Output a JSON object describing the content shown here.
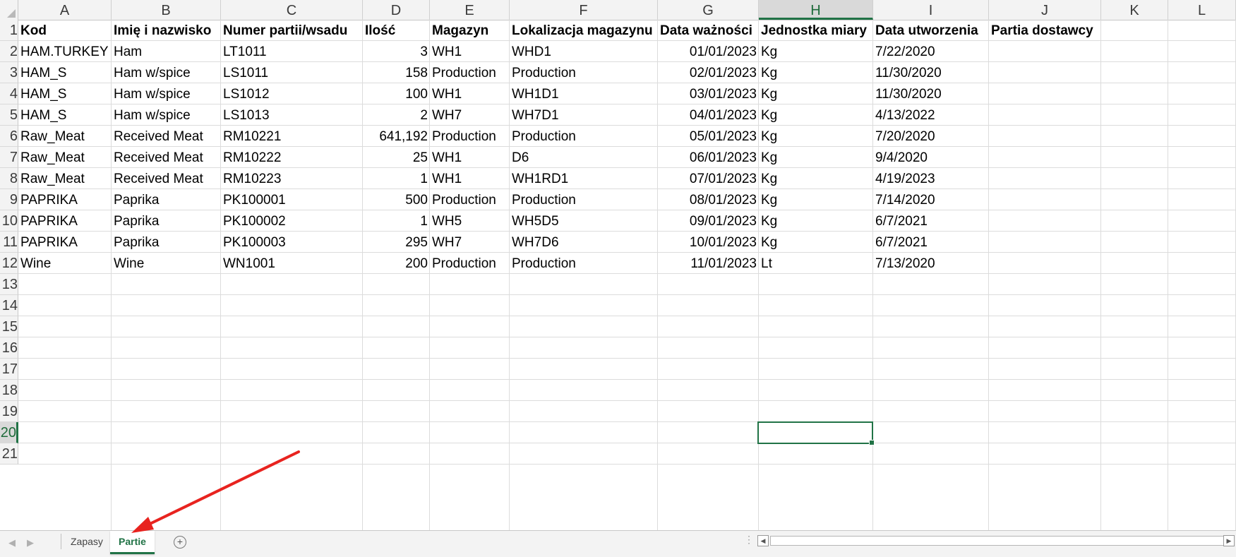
{
  "columns": [
    {
      "letter": "A"
    },
    {
      "letter": "B"
    },
    {
      "letter": "C"
    },
    {
      "letter": "D"
    },
    {
      "letter": "E"
    },
    {
      "letter": "F"
    },
    {
      "letter": "G"
    },
    {
      "letter": "H"
    },
    {
      "letter": "I"
    },
    {
      "letter": "J"
    },
    {
      "letter": "K"
    },
    {
      "letter": "L"
    }
  ],
  "active_column": "H",
  "active_row": "20",
  "rows": [
    "1",
    "2",
    "3",
    "4",
    "5",
    "6",
    "7",
    "8",
    "9",
    "10",
    "11",
    "12",
    "13",
    "14",
    "15",
    "16",
    "17",
    "18",
    "19",
    "20",
    "21"
  ],
  "table": {
    "headers": [
      "Kod",
      "Imię i nazwisko",
      "Numer partii/wsadu",
      "Ilość",
      "Magazyn",
      "Lokalizacja magazynu",
      "Data ważności",
      "Jednostka miary",
      "Data utworzenia",
      "Partia dostawcy"
    ],
    "rows": [
      [
        "HAM.TURKEY",
        "Ham",
        "LT1011",
        "3",
        "WH1",
        "WHD1",
        "01/01/2023",
        "Kg",
        "7/22/2020",
        ""
      ],
      [
        "HAM_S",
        "Ham w/spice",
        "LS1011",
        "158",
        "Production",
        "Production",
        "02/01/2023",
        "Kg",
        "11/30/2020",
        ""
      ],
      [
        "HAM_S",
        "Ham w/spice",
        "LS1012",
        "100",
        "WH1",
        "WH1D1",
        "03/01/2023",
        "Kg",
        "11/30/2020",
        ""
      ],
      [
        "HAM_S",
        "Ham w/spice",
        "LS1013",
        "2",
        "WH7",
        "WH7D1",
        "04/01/2023",
        "Kg",
        "4/13/2022",
        ""
      ],
      [
        "Raw_Meat",
        "Received Meat",
        "RM10221",
        "641,192",
        "Production",
        "Production",
        "05/01/2023",
        "Kg",
        "7/20/2020",
        ""
      ],
      [
        "Raw_Meat",
        "Received Meat",
        "RM10222",
        "25",
        "WH1",
        "D6",
        "06/01/2023",
        "Kg",
        "9/4/2020",
        ""
      ],
      [
        "Raw_Meat",
        "Received Meat",
        "RM10223",
        "1",
        "WH1",
        "WH1RD1",
        "07/01/2023",
        "Kg",
        "4/19/2023",
        ""
      ],
      [
        "PAPRIKA",
        "Paprika",
        "PK100001",
        "500",
        "Production",
        "Production",
        "08/01/2023",
        "Kg",
        "7/14/2020",
        ""
      ],
      [
        "PAPRIKA",
        "Paprika",
        "PK100002",
        "1",
        "WH5",
        "WH5D5",
        "09/01/2023",
        "Kg",
        "6/7/2021",
        ""
      ],
      [
        "PAPRIKA",
        "Paprika",
        "PK100003",
        "295",
        "WH7",
        "WH7D6",
        "10/01/2023",
        "Kg",
        "6/7/2021",
        ""
      ],
      [
        "Wine",
        "Wine",
        "WN1001",
        "200",
        "Production",
        "Production",
        "11/01/2023",
        "Lt",
        "7/13/2020",
        ""
      ]
    ]
  },
  "sheet_tabs": [
    {
      "label": "Zapasy",
      "active": false
    },
    {
      "label": "Partie",
      "active": true
    }
  ],
  "add_sheet_symbol": "+",
  "tab_menu_dots": "⋮",
  "colors": {
    "accent": "#217346",
    "annotation_arrow": "#e8231f"
  }
}
